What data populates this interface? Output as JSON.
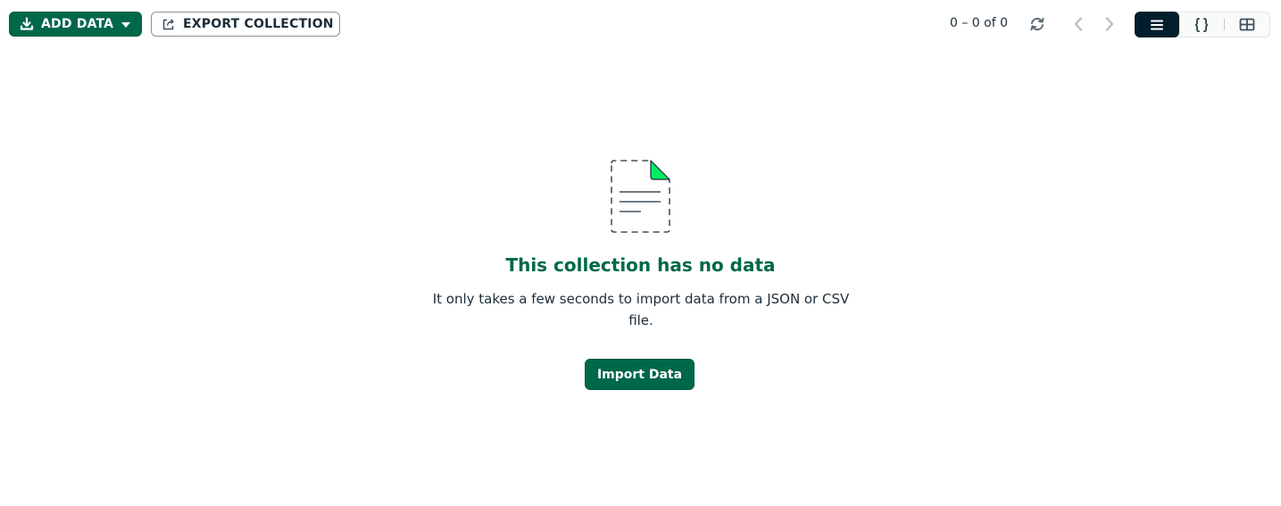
{
  "toolbar": {
    "add_data": {
      "label": "ADD DATA",
      "icon": "download-icon",
      "dropdown_icon": "caret-down-icon"
    },
    "export_collection": {
      "label": "EXPORT COLLECTION",
      "icon": "export-icon"
    },
    "pagination": {
      "text": "0 – 0 of 0",
      "refresh_icon": "refresh-icon",
      "prev_icon": "chevron-left-icon",
      "next_icon": "chevron-right-icon"
    },
    "view_modes": [
      {
        "name": "list",
        "icon": "list-view-icon",
        "active": true
      },
      {
        "name": "json",
        "icon": "json-view-icon",
        "active": false
      },
      {
        "name": "table",
        "icon": "table-view-icon",
        "active": false
      }
    ]
  },
  "empty_state": {
    "illustration_icon": "empty-document-icon",
    "title": "This collection has no data",
    "description": "It only takes a few seconds to import data from a JSON or CSV file.",
    "import_button_label": "Import Data"
  },
  "colors": {
    "primary_green": "#00684a",
    "accent_green": "#00ed64",
    "dark": "#001e2b",
    "text": "#1c2d38"
  }
}
